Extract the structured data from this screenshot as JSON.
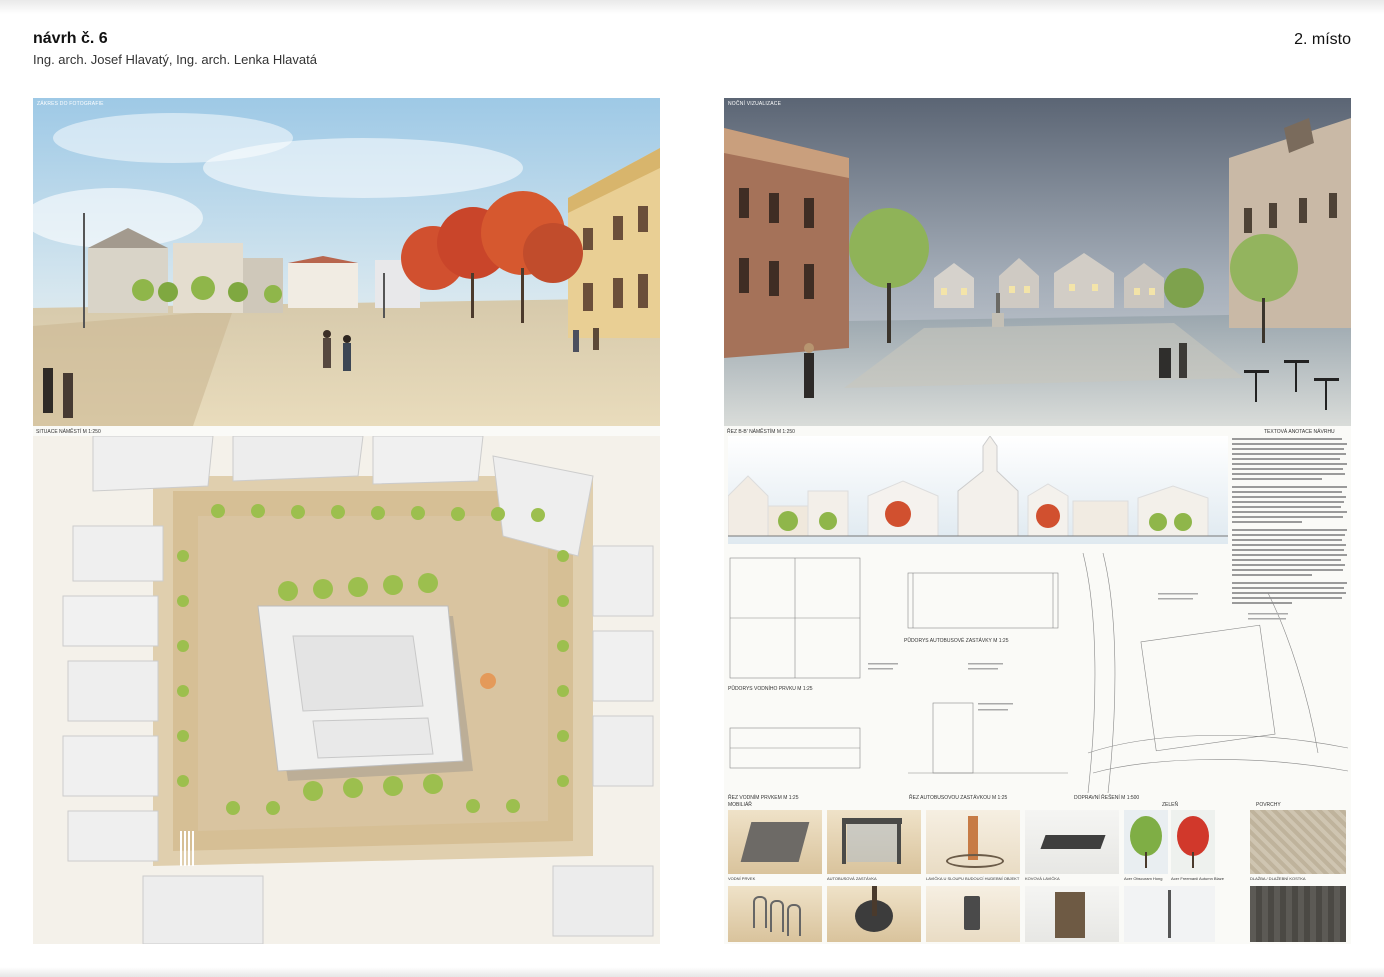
{
  "header": {
    "title": "návrh č. 6",
    "authors": "Ing. arch. Josef Hlavatý, Ing. arch. Lenka Hlavatá",
    "placement": "2. místo"
  },
  "left_sheet": {
    "photo_label": "ZÁKRES DO FOTOGRAFIE",
    "plan_label": "SITUACE NÁMĚSTÍ M 1:250"
  },
  "right_sheet": {
    "photo_label": "NOČNÍ VIZUALIZACE",
    "section_label": "ŘEZ B-B' NÁMĚSTÍM M 1:250",
    "text_heading": "TEXTOVÁ ANOTACE NÁVRHU",
    "drawings": {
      "water_plan": "PŮDORYS VODNÍHO PRVKU M 1:25",
      "bus_plan": "PŮDORYS AUTOBUSOVÉ ZASTÁVKY M 1:25",
      "water_section": "ŘEZ VODNÍM PRVKEM M 1:25",
      "bus_section": "ŘEZ AUTOBUSOVOU ZASTÁVKOU M 1:25",
      "traffic": "DOPRAVNÍ ŘEŠENÍ M 1:500"
    },
    "catalog_headings": {
      "furniture": "MOBILIÁŘ",
      "greenery": "ZELEŇ",
      "surfaces": "POVRCHY"
    },
    "catalog_labels": {
      "water": "VODNÍ PRVEK",
      "bus_stop": "AUTOBUSOVÁ ZASTÁVKA",
      "lamp": "LAVIČKA U SLOUPU BUDOUCÍ HUDEBNÍ OBJEKT",
      "bench": "KOVOVÁ LAVIČKA",
      "tree1": "Acer Obscuram Hong",
      "tree2": "Acer Freemanii Autumn Blaze",
      "surface": "DLAŽBA / DLAŽEBNÍ KOSTKA"
    }
  },
  "colors": {
    "sky_day": "#a9cde4",
    "sky_night": "#6f7d8c",
    "pavement": "#d8c4a0",
    "autumn_tree": "#d1502f",
    "green_tree": "#8fb64a"
  }
}
